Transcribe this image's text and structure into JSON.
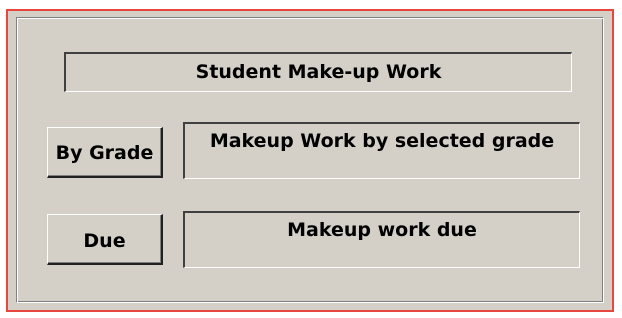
{
  "form": {
    "title": "Student Make-up Work",
    "grade_button_label": "By Grade",
    "grade_description": "Makeup Work by selected grade",
    "due_button_label": "Due",
    "due_description": "Makeup work due"
  },
  "colors": {
    "outer_border": "#e8473f",
    "face": "#d4d0c8"
  }
}
